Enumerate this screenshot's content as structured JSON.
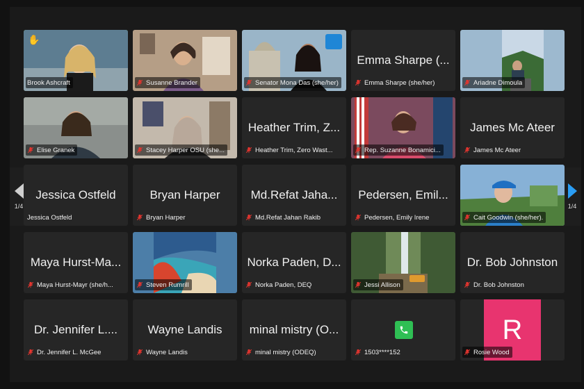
{
  "pager": {
    "left_page": "1/4",
    "right_page": "1/4"
  },
  "colors": {
    "active_border": "#6ac24b",
    "muted": "#e5352f",
    "avatar_rosie": "#e8346f",
    "phone": "#2fbf54",
    "next_arrow": "#2a9df4"
  },
  "tiles": [
    {
      "label": "Brook Ashcraft",
      "big": "",
      "type": "video",
      "icons": [
        "raised-hand-icon"
      ],
      "active": true
    },
    {
      "label": "Susanne Brander",
      "big": "",
      "type": "video"
    },
    {
      "label": "Senator Mona Das (she/her)",
      "big": "",
      "type": "video"
    },
    {
      "label": "Emma Sharpe (she/her)",
      "big": "Emma Sharpe (...",
      "type": "name"
    },
    {
      "label": "Ariadne Dimoula",
      "big": "",
      "type": "video"
    },
    {
      "label": "Elise Granek",
      "big": "",
      "type": "video"
    },
    {
      "label": "Stacey Harper OSU (she...",
      "big": "",
      "type": "video"
    },
    {
      "label": "Heather Trim, Zero Wast...",
      "big": "Heather Trim, Z...",
      "type": "name"
    },
    {
      "label": "Rep. Suzanne Bonamici...",
      "big": "",
      "type": "video"
    },
    {
      "label": "James Mc Ateer",
      "big": "James Mc Ateer",
      "type": "name"
    },
    {
      "label": "Jessica Ostfeld",
      "big": "Jessica Ostfeld",
      "type": "name"
    },
    {
      "label": "Bryan Harper",
      "big": "Bryan Harper",
      "type": "name"
    },
    {
      "label": "Md.Refat Jahan Rakib",
      "big": "Md.Refat Jaha...",
      "type": "name"
    },
    {
      "label": "Pedersen, Emily Irene",
      "big": "Pedersen, Emil...",
      "type": "name"
    },
    {
      "label": "Cait Goodwin (she/her).",
      "big": "",
      "type": "video"
    },
    {
      "label": "Maya Hurst-Mayr (she/h...",
      "big": "Maya Hurst-Ma...",
      "type": "name"
    },
    {
      "label": "Steven Rumrill",
      "big": "",
      "type": "video"
    },
    {
      "label": "Norka Paden, DEQ",
      "big": "Norka Paden, D...",
      "type": "name"
    },
    {
      "label": "Jessi Allison",
      "big": "",
      "type": "video"
    },
    {
      "label": "Dr. Bob Johnston",
      "big": "Dr. Bob Johnston",
      "type": "name"
    },
    {
      "label": "Dr. Jennifer L. McGee",
      "big": "Dr. Jennifer L....",
      "type": "name"
    },
    {
      "label": "Wayne Landis",
      "big": "Wayne Landis",
      "type": "name"
    },
    {
      "label": "minal mistry (ODEQ)",
      "big": "minal mistry (O...",
      "type": "name"
    },
    {
      "label": "1503****152",
      "big": "",
      "type": "phone"
    },
    {
      "label": "Rosie Wood",
      "big": "R",
      "type": "avatar"
    }
  ]
}
